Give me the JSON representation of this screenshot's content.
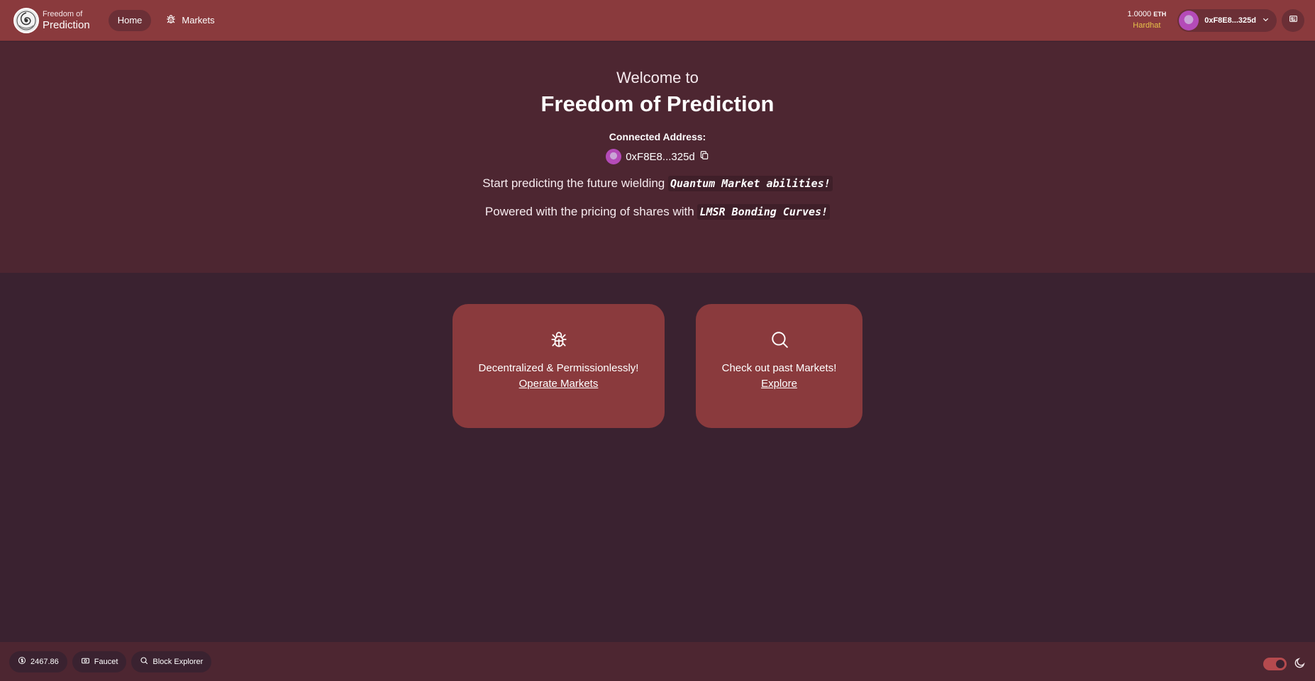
{
  "header": {
    "brand_top": "Freedom of",
    "brand_bottom": "Prediction",
    "nav": [
      {
        "label": "Home",
        "active": true
      },
      {
        "label": "Markets",
        "icon": "bug-icon"
      }
    ],
    "balance_amount": "1.0000",
    "balance_unit": "ETH",
    "network": "Hardhat",
    "account": "0xF8E8...325d"
  },
  "hero": {
    "welcome": "Welcome to",
    "title": "Freedom of Prediction",
    "connected_label": "Connected Address:",
    "address": "0xF8E8...325d",
    "line1_prefix": "Start predicting the future wielding",
    "line1_code": "Quantum Market abilities!",
    "line2_prefix": "Powered with the pricing of shares with",
    "line2_code": "LMSR Bonding Curves!"
  },
  "cards": [
    {
      "icon": "bug-icon",
      "text": "Decentralized & Permissionlessly!",
      "link": "Operate Markets"
    },
    {
      "icon": "search-icon",
      "text": "Check out past Markets!",
      "link": "Explore"
    }
  ],
  "footer": {
    "price": "2467.86",
    "faucet": "Faucet",
    "explorer": "Block Explorer"
  },
  "colors": {
    "header": "#8a3a3d",
    "hero": "#4d2631",
    "background": "#3a2230",
    "network": "#e6c24a"
  }
}
